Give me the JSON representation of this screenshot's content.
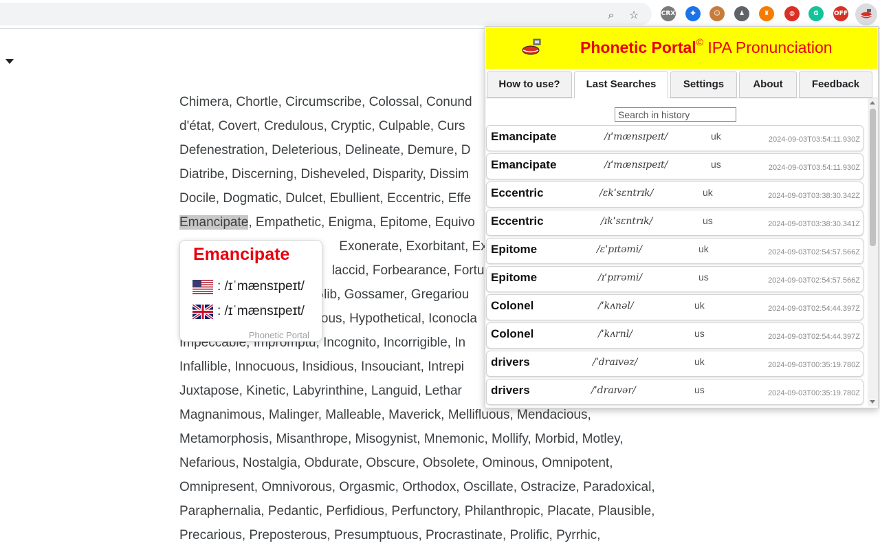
{
  "browser": {
    "zoom_icon": "magnifier-zoom-icon",
    "bookmark_icon": "star-icon",
    "extensions": [
      {
        "name": "crx-extension-icon",
        "label": "CRX",
        "color": "#7a7a7a"
      },
      {
        "name": "blue-circle-extension-icon",
        "label": "✚",
        "color": "#1a73e8"
      },
      {
        "name": "person-extension-icon",
        "label": "☺",
        "color": "#c67c3b"
      },
      {
        "name": "robot-extension-icon",
        "label": "♟",
        "color": "#5f6368"
      },
      {
        "name": "orange-extension-icon",
        "label": "♜",
        "color": "#f57c00"
      },
      {
        "name": "globe-extension-icon",
        "label": "◍",
        "color": "#d93025"
      },
      {
        "name": "grammarly-extension-icon",
        "label": "G",
        "color": "#15c39a"
      },
      {
        "name": "off-badge-extension-icon",
        "label": "OFF",
        "color": "#d93025"
      }
    ]
  },
  "page": {
    "lines": [
      {
        "text": "Chimera, Chortle, Circumscribe, Colossal, Conund"
      },
      {
        "text": "d'état, Covert, Credulous, Cryptic, Culpable, Curs"
      },
      {
        "text": "Defenestration, Deleterious, Delineate, Demure, D"
      },
      {
        "text": "Diatribe, Discerning, Disheveled, Disparity, Dissim"
      },
      {
        "text": "Docile, Dogmatic, Dulcet, Ebullient, Eccentric, Effe"
      },
      {
        "highlight": "Emancipate",
        "text": ", Empathetic, Enigma, Epitome, Equivo"
      },
      {
        "text": "                                            Exonerate, Exorbitant, Ex"
      },
      {
        "text": "                                          laccid, Forbearance, Fortu"
      },
      {
        "text": "                                     Glib, Gossamer, Gregariou"
      },
      {
        "text": "                                       ous, Hypothetical, Iconocla"
      },
      {
        "text": "Impeccable, Impromptu, Incognito, Incorrigible, In"
      },
      {
        "text": "Infallible, Innocuous, Insidious, Insouciant, Intrepi"
      },
      {
        "text": "Juxtapose, Kinetic, Labyrinthine, Languid, Lethar"
      },
      {
        "text": "Magnanimous, Malinger, Malleable, Maverick, Mellifluous, Mendacious,"
      },
      {
        "text": "Metamorphosis, Misanthrope, Misogynist, Mnemonic, Mollify, Morbid, Motley,"
      },
      {
        "text": "Nefarious, Nostalgia, Obdurate, Obscure, Obsolete, Ominous, Omnipotent,"
      },
      {
        "text": "Omnipresent, Omnivorous, Orgasmic, Orthodox, Oscillate, Ostracize, Paradoxical,"
      },
      {
        "text": "Paraphernalia, Pedantic, Perfidious, Perfunctory, Philanthropic, Placate, Plausible,"
      },
      {
        "text": "Precarious, Preposterous, Presumptuous, Procrastinate, Prolific, Pyrrhic,"
      }
    ]
  },
  "tooltip": {
    "word": "Emancipate",
    "us_ipa": ": /ɪˈmænsɪpeɪt/",
    "uk_ipa": ": /ɪˈmænsɪpeɪt/",
    "brand": "Phonetic Portal"
  },
  "popup": {
    "title_bold": "Phonetic Portal",
    "title_sup": "©",
    "title_rest": " IPA Pronunciation",
    "tabs": [
      {
        "label": "How to use?"
      },
      {
        "label": "Last Searches"
      },
      {
        "label": "Settings"
      },
      {
        "label": "About"
      },
      {
        "label": "Feedback"
      }
    ],
    "active_tab": "Last Searches",
    "search_placeholder": "Search in history",
    "history": [
      {
        "word": "Emancipate",
        "ipa": "/ɪˈmænsɪpeɪt/",
        "dialect": "uk",
        "time": "2024-09-03T03:54:11.930Z"
      },
      {
        "word": "Emancipate",
        "ipa": "/ɪˈmænsɪpeɪt/",
        "dialect": "us",
        "time": "2024-09-03T03:54:11.930Z"
      },
      {
        "word": "Eccentric",
        "ipa": "/ɛkˈsɛntrɪk/",
        "dialect": "uk",
        "time": "2024-09-03T03:38:30.342Z"
      },
      {
        "word": "Eccentric",
        "ipa": "/ɪkˈsɛntrɪk/",
        "dialect": "us",
        "time": "2024-09-03T03:38:30.341Z"
      },
      {
        "word": "Epitome",
        "ipa": "/ɛˈpɪtəmi/",
        "dialect": "uk",
        "time": "2024-09-03T02:54:57.566Z"
      },
      {
        "word": "Epitome",
        "ipa": "/ɪˈpɪrəmi/",
        "dialect": "us",
        "time": "2024-09-03T02:54:57.566Z"
      },
      {
        "word": "Colonel",
        "ipa": "/ˈkʌnəl/",
        "dialect": "uk",
        "time": "2024-09-03T02:54:44.397Z"
      },
      {
        "word": "Colonel",
        "ipa": "/ˈkʌrnl/",
        "dialect": "us",
        "time": "2024-09-03T02:54:44.397Z"
      },
      {
        "word": "drivers",
        "ipa": "/ˈdraɪvəz/",
        "dialect": "uk",
        "time": "2024-09-03T00:35:19.780Z"
      },
      {
        "word": "drivers",
        "ipa": "/ˈdraɪvər/",
        "dialect": "us",
        "time": "2024-09-03T00:35:19.780Z"
      }
    ]
  },
  "colors": {
    "brand_red": "#e8000d",
    "header_yellow": "#ffff00"
  }
}
